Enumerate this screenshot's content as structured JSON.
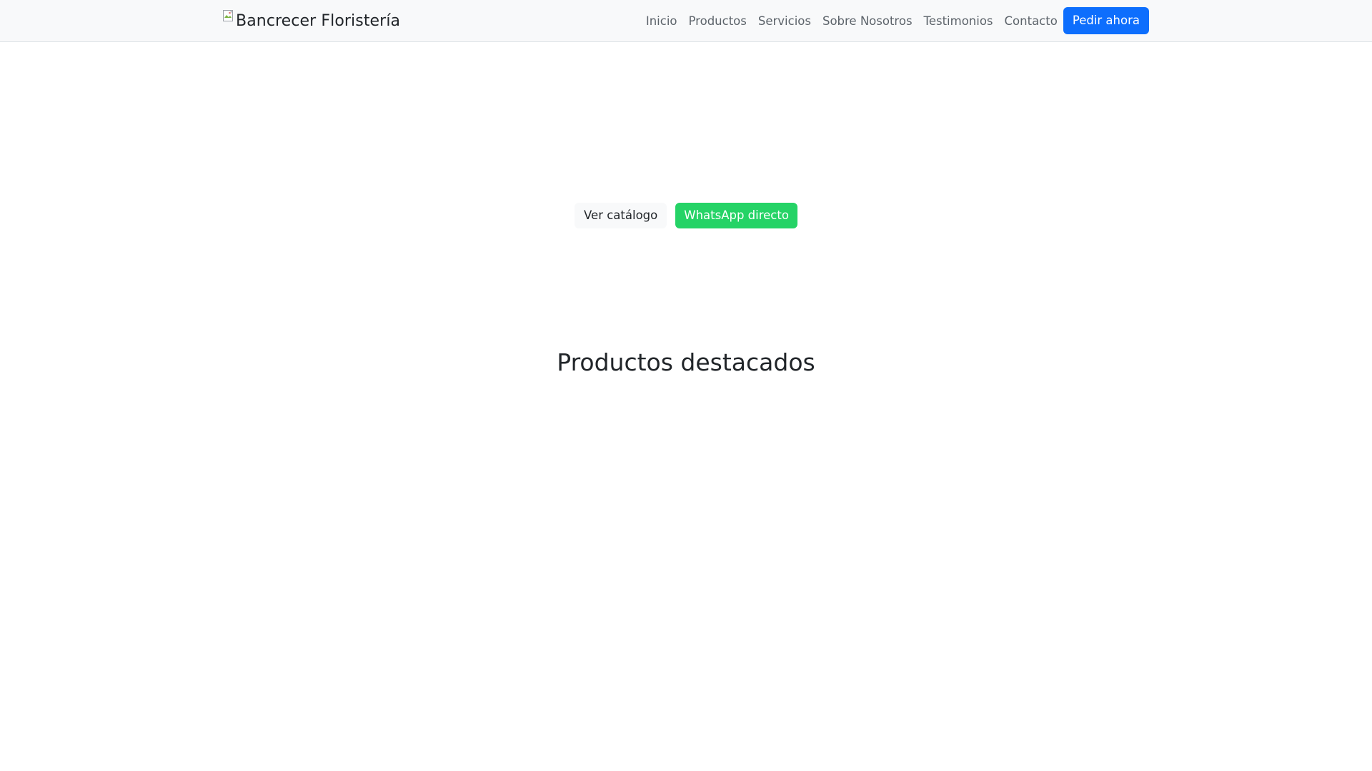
{
  "navbar": {
    "brand_alt": "Bancrecer Floristería",
    "links": [
      {
        "label": "Inicio"
      },
      {
        "label": "Productos"
      },
      {
        "label": "Servicios"
      },
      {
        "label": "Sobre Nosotros"
      },
      {
        "label": "Testimonios"
      },
      {
        "label": "Contacto"
      }
    ],
    "cta_label": "Pedir ahora"
  },
  "hero": {
    "catalog_label": "Ver catálogo",
    "whatsapp_label": "WhatsApp directo"
  },
  "featured": {
    "title": "Productos destacados"
  },
  "colors": {
    "primary": "#0d6efd",
    "whatsapp": "#25d366",
    "navbar_bg": "#f8f9fa",
    "nav_text": "#5c636a"
  },
  "icons": {
    "brand": "broken-image-icon"
  }
}
